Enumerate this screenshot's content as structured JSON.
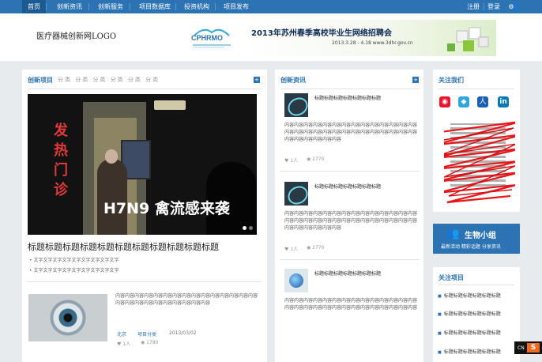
{
  "nav": {
    "items": [
      "首页",
      "创新资讯",
      "创新服务",
      "项目数据库",
      "投资机构",
      "项目发布"
    ],
    "right": [
      "注册",
      "登录"
    ]
  },
  "header": {
    "logo_text": "医疗器械创新网LOGO",
    "cphrmo": "CPHRMO",
    "ad_title": "2013年苏州春季高校毕业生网络招聘会",
    "ad_date": "2013.3.28 - 4.18 www.3dhr.gov.cn"
  },
  "innovation_projects": {
    "title": "创新项目",
    "tabs": "分类 分类 分类 分类 分类 分类",
    "hero_sign": [
      "发",
      "热",
      "门",
      "诊"
    ],
    "hero_caption": "H7N9 禽流感来袭",
    "headline": "标题标题标题标题标题标题标题标题标题标题标题",
    "bullets": [
      "• 文字文字文字文字文字文字文字文字文字",
      "• 文字文字文字文字文字文字文字文字文字"
    ],
    "item": {
      "text": "内容内容内容内容内容内容内容内容内容内容内容内容内容内容内容内容内容内容内容内容内容内容内容内容内容",
      "location": "北京",
      "category": "项目分类",
      "date": "2013/03/02",
      "likes": "♥ 1人",
      "views": "◉ 1780"
    }
  },
  "innovation_news": {
    "title": "创新资讯",
    "items": [
      {
        "title": "标题标题标题标题标题标题标题",
        "body": "内容内容内容内容内容内容内容内容内容内容内容内容内容内容内容内容内容内容内容内容内容内容内容内容内容内容内容内容内容内容内容内容内容内容",
        "likes": "♥ 1人",
        "views": "◉ 2770"
      },
      {
        "title": "标题标题标题标题标题标题标题",
        "body": "内容内容内容内容内容内容内容内容内容内容内容内容内容内容内容内容内容内容内容内容内容内容内容内容内容内容内容内容内容内容内容内容内容内容",
        "likes": "♥ 1人",
        "views": "◉ 2770"
      },
      {
        "title": "标题标题标题标题标题标题标题",
        "body": "内容内容内容内容内容内容内容内容内容内容内容内容内容内容内容内容内容内容内容内容内容内容内容内容内容内容内容内容",
        "likes": "",
        "views": ""
      }
    ]
  },
  "follow_us": {
    "title": "关注我们",
    "social_icons": [
      "weibo-icon",
      "qq-icon",
      "renren-icon",
      "linkedin-icon"
    ]
  },
  "bio_group": {
    "title": "生物小组",
    "links": "最新活动  精彩话题  分享资讯"
  },
  "follow_projects": {
    "title": "关注项目",
    "items": [
      "标题标题标题标题标题标题",
      "标题标题标题标题标题标题",
      "标题标题标题标题标题标题",
      "标题标题标题标题标题标题"
    ]
  },
  "colors": {
    "accent": "#2b73b2",
    "page_bg": "#e8ebee"
  }
}
